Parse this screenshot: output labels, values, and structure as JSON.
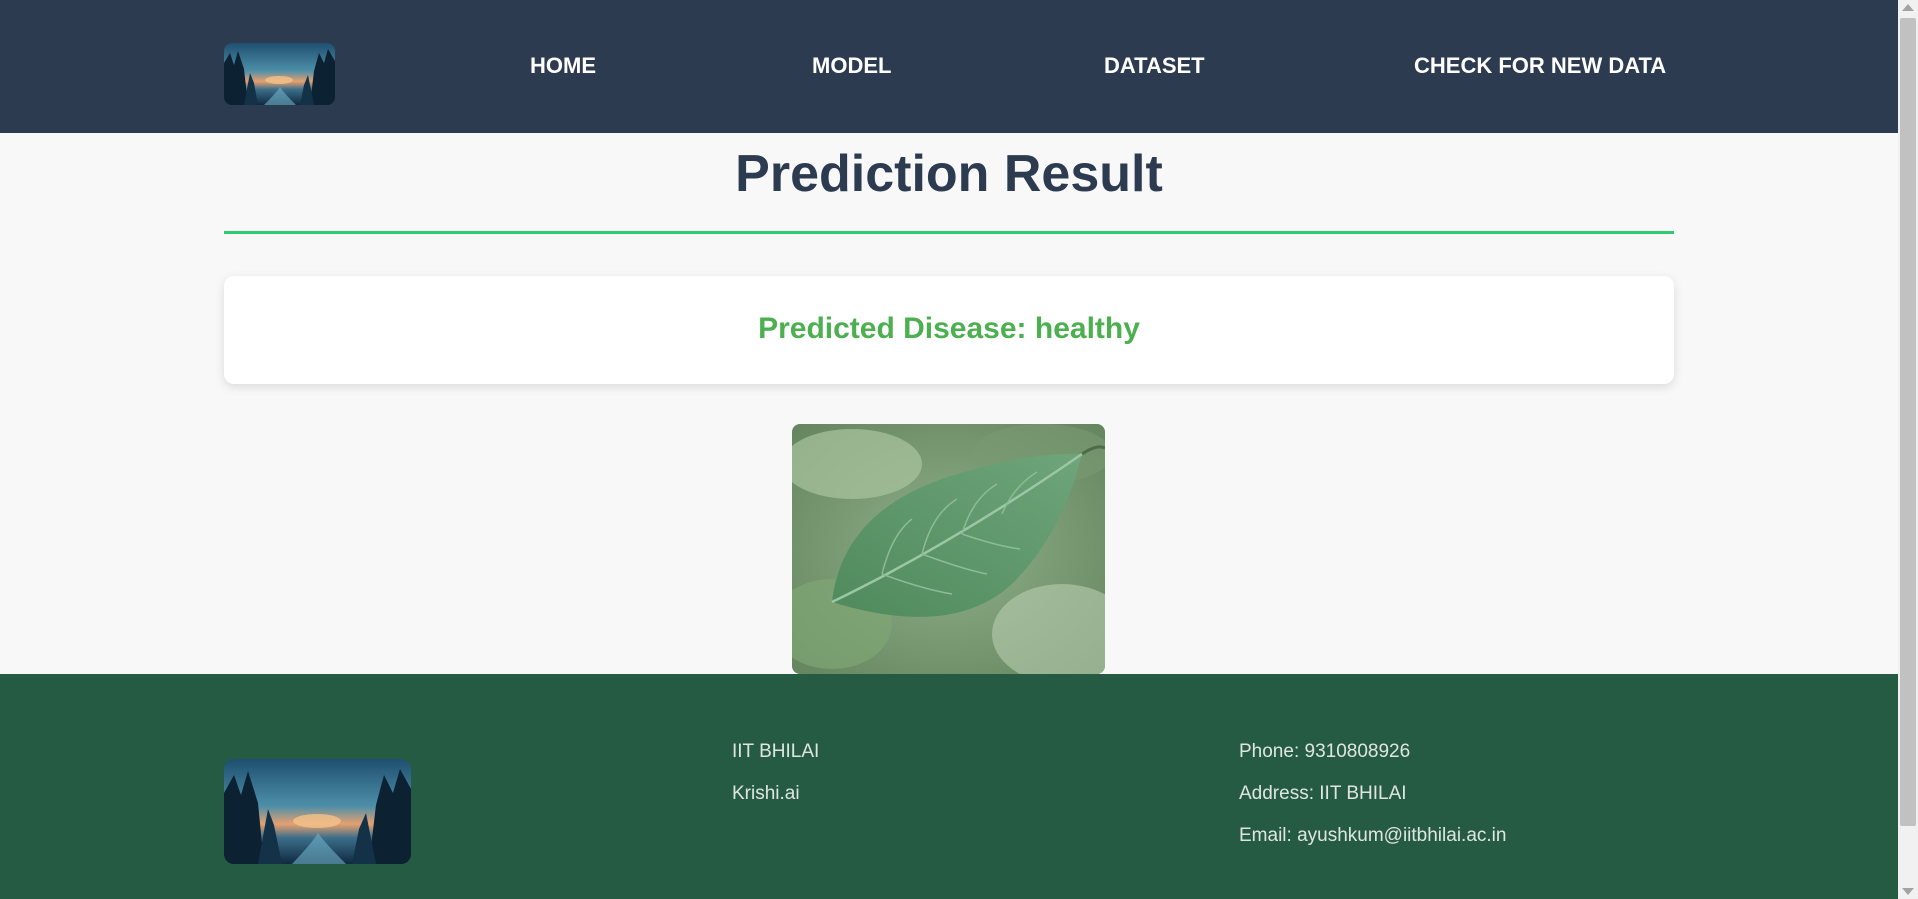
{
  "navbar": {
    "logo_icon": "forest-sunset-logo",
    "links": [
      {
        "label": "HOME"
      },
      {
        "label": "MODEL"
      },
      {
        "label": "DATASET"
      },
      {
        "label": "CHECK FOR NEW DATA"
      }
    ]
  },
  "main": {
    "title": "Prediction Result",
    "prediction_text": "Predicted Disease: healthy",
    "image_subject": "leaf-photo"
  },
  "footer": {
    "logo_icon": "forest-sunset-logo",
    "column1": [
      "IIT BHILAI",
      "Krishi.ai"
    ],
    "column2": [
      "Phone: 9310808926",
      "Address: IIT BHILAI",
      "Email: ayushkum@iitbhilai.ac.in"
    ]
  },
  "colors": {
    "navbar_bg": "#2d3b50",
    "title": "#2d3b50",
    "rule": "#2ecc71",
    "prediction": "#4caf50",
    "footer_bg": "#265b43"
  }
}
